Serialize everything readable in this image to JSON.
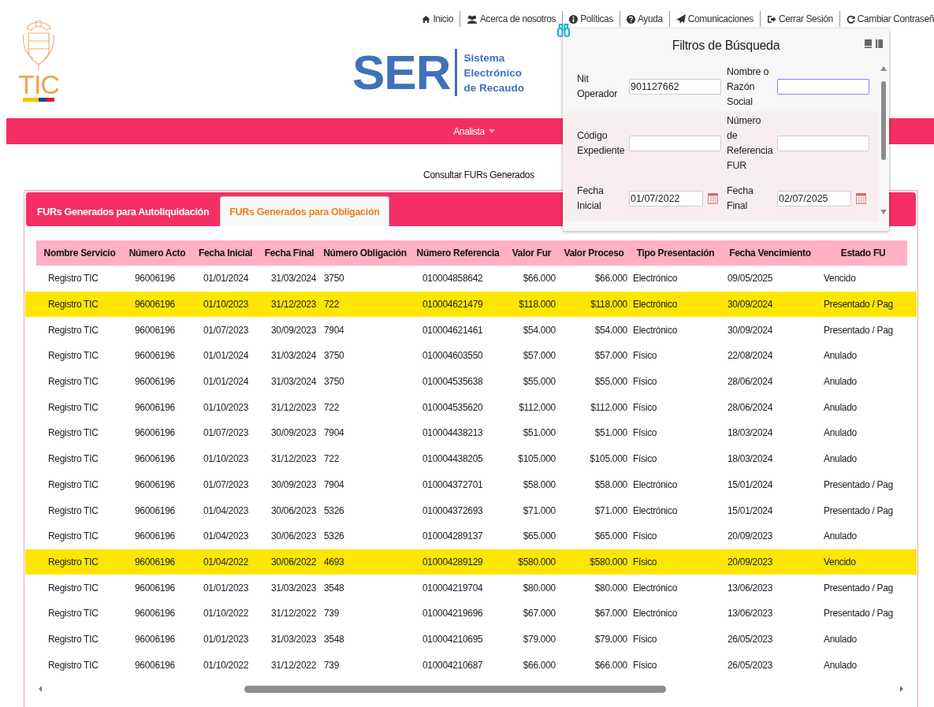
{
  "top_nav": [
    {
      "label": "Inicio"
    },
    {
      "label": "Acerca de nosotros"
    },
    {
      "label": "Políticas"
    },
    {
      "label": "Ayuda"
    },
    {
      "label": "Comunicaciones"
    },
    {
      "label": "Cerrar Sesión"
    },
    {
      "label": "Cambiar Contraseñ"
    }
  ],
  "logo_left": {
    "text": "TIC"
  },
  "logo_center": {
    "mark": "SER",
    "subtitle": "Sistema Electrónico de Recaudo"
  },
  "menu_bar": {
    "label": "Analista"
  },
  "page_title": "Consultar FURs Generados",
  "tabs": [
    {
      "label": "FURs Generados para Autoliquidación",
      "selected": false
    },
    {
      "label": "FURs Generados para Obligación",
      "selected": true
    }
  ],
  "table": {
    "columns": [
      "Nombre Servicio",
      "Número Acto",
      "Fecha Inicial",
      "Fecha Final",
      "Número Obligación",
      "Número Referencia",
      "Valor Fur",
      "Valor Proceso",
      "Tipo Presentación",
      "Fecha Vencimiento",
      "Estado FU"
    ],
    "rows": [
      {
        "selected": false,
        "cells": [
          "Registro TIC",
          "96006196",
          "01/01/2024",
          "31/03/2024",
          "3750",
          "010004858642",
          "$66.000",
          "$66.000",
          "Electrónico",
          "09/05/2025",
          "Vencido"
        ]
      },
      {
        "selected": true,
        "cells": [
          "Registro TIC",
          "96006196",
          "01/10/2023",
          "31/12/2023",
          "722",
          "010004621479",
          "$118.000",
          "$118.000",
          "Electrónico",
          "30/09/2024",
          "Presentado / Pag"
        ]
      },
      {
        "selected": false,
        "cells": [
          "Registro TIC",
          "96006196",
          "01/07/2023",
          "30/09/2023",
          "7904",
          "010004621461",
          "$54.000",
          "$54.000",
          "Electrónico",
          "30/09/2024",
          "Presentado / Pag"
        ]
      },
      {
        "selected": false,
        "cells": [
          "Registro TIC",
          "96006196",
          "01/01/2024",
          "31/03/2024",
          "3750",
          "010004603550",
          "$57.000",
          "$57.000",
          "Físico",
          "22/08/2024",
          "Anulado"
        ]
      },
      {
        "selected": false,
        "cells": [
          "Registro TIC",
          "96006196",
          "01/01/2024",
          "31/03/2024",
          "3750",
          "010004535638",
          "$55.000",
          "$55.000",
          "Físico",
          "28/06/2024",
          "Anulado"
        ]
      },
      {
        "selected": false,
        "cells": [
          "Registro TIC",
          "96006196",
          "01/10/2023",
          "31/12/2023",
          "722",
          "010004535620",
          "$112.000",
          "$112.000",
          "Físico",
          "28/06/2024",
          "Anulado"
        ]
      },
      {
        "selected": false,
        "cells": [
          "Registro TIC",
          "96006196",
          "01/07/2023",
          "30/09/2023",
          "7904",
          "010004438213",
          "$51.000",
          "$51.000",
          "Físico",
          "18/03/2024",
          "Anulado"
        ]
      },
      {
        "selected": false,
        "cells": [
          "Registro TIC",
          "96006196",
          "01/10/2023",
          "31/12/2023",
          "722",
          "010004438205",
          "$105.000",
          "$105.000",
          "Físico",
          "18/03/2024",
          "Anulado"
        ]
      },
      {
        "selected": false,
        "cells": [
          "Registro TIC",
          "96006196",
          "01/07/2023",
          "30/09/2023",
          "7904",
          "010004372701",
          "$58.000",
          "$58.000",
          "Electrónico",
          "15/01/2024",
          "Presentado / Pag"
        ]
      },
      {
        "selected": false,
        "cells": [
          "Registro TIC",
          "96006196",
          "01/04/2023",
          "30/06/2023",
          "5326",
          "010004372693",
          "$71.000",
          "$71.000",
          "Electrónico",
          "15/01/2024",
          "Presentado / Pag"
        ]
      },
      {
        "selected": false,
        "cells": [
          "Registro TIC",
          "96006196",
          "01/04/2023",
          "30/06/2023",
          "5326",
          "010004289137",
          "$65.000",
          "$65.000",
          "Físico",
          "20/09/2023",
          "Anulado"
        ]
      },
      {
        "selected": true,
        "cells": [
          "Registro TIC",
          "96006196",
          "01/04/2022",
          "30/06/2022",
          "4693",
          "010004289129",
          "$580.000",
          "$580.000",
          "Físico",
          "20/09/2023",
          "Vencido"
        ]
      },
      {
        "selected": false,
        "cells": [
          "Registro TIC",
          "96006196",
          "01/01/2023",
          "31/03/2023",
          "3548",
          "010004219704",
          "$80.000",
          "$80.000",
          "Electrónico",
          "13/06/2023",
          "Presentado / Pag"
        ]
      },
      {
        "selected": false,
        "cells": [
          "Registro TIC",
          "96006196",
          "01/10/2022",
          "31/12/2022",
          "739",
          "010004219696",
          "$67.000",
          "$67.000",
          "Electrónico",
          "13/06/2023",
          "Presentado / Pag"
        ]
      },
      {
        "selected": false,
        "cells": [
          "Registro TIC",
          "96006196",
          "01/01/2023",
          "31/03/2023",
          "3548",
          "010004210695",
          "$79.000",
          "$79.000",
          "Físico",
          "26/05/2023",
          "Anulado"
        ]
      },
      {
        "selected": false,
        "cells": [
          "Registro TIC",
          "96006196",
          "01/10/2022",
          "31/12/2022",
          "739",
          "010004210687",
          "$66.000",
          "$66.000",
          "Físico",
          "26/05/2023",
          "Anulado"
        ]
      }
    ]
  },
  "filter_panel": {
    "title": "Filtros de Búsqueda",
    "rows": [
      [
        {
          "label": "Nit Operador",
          "value": "901127662",
          "kind": "text"
        },
        {
          "label": "Nombre o Razón Social",
          "kind": "text"
        }
      ],
      [
        {
          "label": "Código Expediente",
          "kind": "text"
        },
        {
          "label": "Número de Referencia FUR",
          "kind": "text"
        }
      ],
      [
        {
          "label": "Fecha Inicial",
          "value": "01/07/2022",
          "kind": "date"
        },
        {
          "label": "Fecha Final",
          "value": "02/07/2025",
          "kind": "date"
        }
      ]
    ]
  }
}
